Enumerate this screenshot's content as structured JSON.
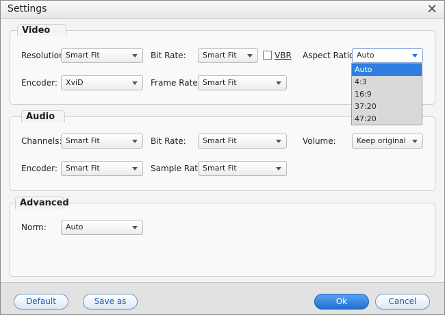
{
  "window": {
    "title": "Settings"
  },
  "video": {
    "title": "Video",
    "resolution_label": "Resolution:",
    "resolution_value": "Smart Fit",
    "bitrate_label": "Bit Rate:",
    "bitrate_value": "Smart Fit",
    "vbr_label": "VBR",
    "aspect_label": "Aspect Ratio:",
    "aspect_value": "Auto",
    "aspect_options": [
      "Auto",
      "4:3",
      "16:9",
      "37:20",
      "47:20"
    ],
    "encoder_label": "Encoder:",
    "encoder_value": "XviD",
    "framerate_label": "Frame Rate:",
    "framerate_value": "Smart Fit"
  },
  "audio": {
    "title": "Audio",
    "channels_label": "Channels:",
    "channels_value": "Smart Fit",
    "bitrate_label": "Bit Rate:",
    "bitrate_value": "Smart Fit",
    "volume_label": "Volume:",
    "volume_value": "Keep original",
    "encoder_label": "Encoder:",
    "encoder_value": "Smart Fit",
    "samplerate_label": "Sample Rate:",
    "samplerate_value": "Smart Fit"
  },
  "advanced": {
    "title": "Advanced",
    "norm_label": "Norm:",
    "norm_value": "Auto"
  },
  "buttons": {
    "default": "Default",
    "save_as": "Save as",
    "ok": "Ok",
    "cancel": "Cancel"
  },
  "colors": {
    "accent": "#2f7fe0",
    "button_text": "#1d5aa8"
  }
}
